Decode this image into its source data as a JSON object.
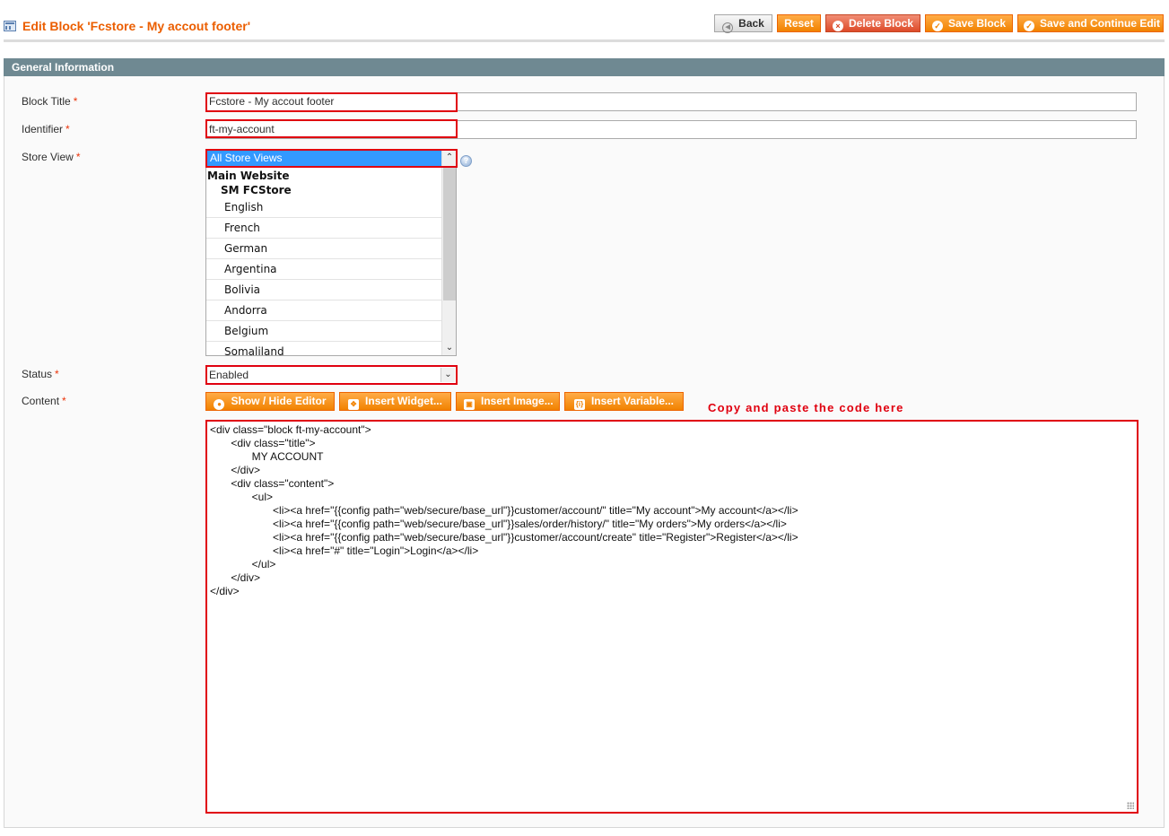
{
  "header": {
    "title": "Edit Block 'Fcstore - My accout footer'",
    "buttons": {
      "back": "Back",
      "reset": "Reset",
      "delete": "Delete Block",
      "save": "Save Block",
      "save_continue": "Save and Continue Edit"
    }
  },
  "section": {
    "title": "General Information"
  },
  "form": {
    "block_title": {
      "label": "Block Title",
      "value": "Fcstore - My accout footer"
    },
    "identifier": {
      "label": "Identifier",
      "value": "ft-my-account"
    },
    "store_view": {
      "label": "Store View",
      "selected": "All Store Views",
      "group_website": "Main Website",
      "group_store": "SM FCStore",
      "options": [
        "English",
        "French",
        "German",
        "Argentina",
        "Bolivia",
        "Andorra",
        "Belgium",
        "Somaliland"
      ]
    },
    "status": {
      "label": "Status",
      "value": "Enabled"
    },
    "content": {
      "label": "Content"
    },
    "required_mark": "*"
  },
  "editor": {
    "buttons": {
      "show_hide": "Show / Hide Editor",
      "widget": "Insert Widget...",
      "image": "Insert Image...",
      "variable": "Insert Variable..."
    },
    "note": "Copy and paste the code here",
    "code": "<div class=\"block ft-my-account\">\n       <div class=\"title\">\n              MY ACCOUNT\n       </div>\n       <div class=\"content\">\n              <ul>\n                     <li><a href=\"{{config path=\"web/secure/base_url\"}}customer/account/\" title=\"My account\">My account</a></li>\n                     <li><a href=\"{{config path=\"web/secure/base_url\"}}sales/order/history/\" title=\"My orders\">My orders</a></li>\n                     <li><a href=\"{{config path=\"web/secure/base_url\"}}customer/account/create\" title=\"Register\">Register</a></li>\n                     <li><a href=\"#\" title=\"Login\">Login</a></li>\n              </ul>\n       </div>\n</div>"
  },
  "icons": {
    "back": "back-arrow-icon",
    "delete": "delete-icon",
    "save": "check-icon",
    "help": "help-icon",
    "grid": "grid-icon"
  }
}
